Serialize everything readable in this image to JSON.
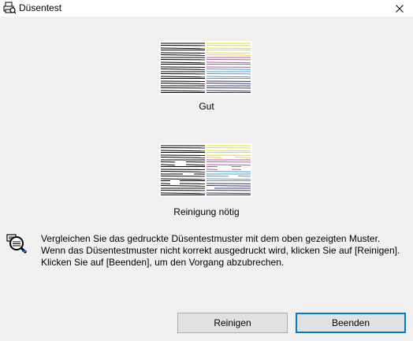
{
  "window": {
    "title": "Düsentest",
    "close_icon": "close-icon",
    "app_icon": "printer-icon"
  },
  "patterns": [
    {
      "caption": "Gut",
      "state": "good"
    },
    {
      "caption": "Reinigung nötig",
      "state": "needs-cleaning"
    }
  ],
  "info_icon": "magnifier-check-icon",
  "message": "Vergleichen Sie das gedruckte Düsentestmuster mit dem oben gezeigten Muster. Wenn das Düsentestmuster nicht korrekt ausgedruckt wird, klicken Sie auf [Reinigen]. Klicken Sie auf [Beenden], um den Vorgang abzubrechen.",
  "buttons": {
    "clean": "Reinigen",
    "finish": "Beenden"
  },
  "colors": {
    "black_ink": "#000000",
    "yellow_ink": "#e6e600",
    "magenta_ink": "#e040c0",
    "cyan_ink": "#40a0e0",
    "blue_ink": "#303080",
    "default_button_border": "#0078d7"
  }
}
